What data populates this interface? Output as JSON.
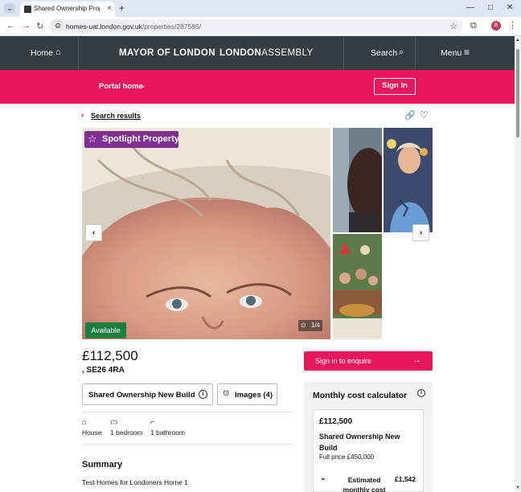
{
  "browser": {
    "tab_title": "Shared Ownership Properties | ...",
    "url_host": "homes-uat.london.gov.uk",
    "url_path": "/properties/287585/",
    "profile_initial": "B",
    "icons": [
      "back-arrow-icon",
      "forward-arrow-icon",
      "reload-icon",
      "site-info-icon",
      "star-icon",
      "extensions-icon",
      "kebab-menu-icon"
    ]
  },
  "header": {
    "home_label": "Home",
    "mayor_label": "MAYOR OF LONDON",
    "assembly_bold": "LONDON",
    "assembly_rest": "ASSEMBLY",
    "search_label": "Search",
    "menu_label": "Menu"
  },
  "subnav": {
    "portal_label": "Portal home",
    "signin_label": "Sign In"
  },
  "page": {
    "back_label": "Search results",
    "spotlight_label": "Spotlight Property",
    "status_badge": "Available",
    "image_counter": "1/4",
    "price": "£112,500",
    "postcode": ", SE26 4RA",
    "enquire_label": "Sign in to enquire",
    "type_button_label": "Shared Ownership New Build",
    "images_button_label": "Images (4)",
    "features": [
      {
        "label": "House",
        "icon": "house-icon"
      },
      {
        "label": "1 bedroom",
        "icon": "bed-icon"
      },
      {
        "label": "1 bathroom",
        "icon": "bath-icon"
      }
    ],
    "summary_heading": "Summary",
    "summary_text": "Test Homes for Londoners Home 1"
  },
  "calculator": {
    "title": "Monthly cost calculator",
    "price": "£112,500",
    "type": "Shared Ownership New Build",
    "full_price": "Full price £450,000",
    "row_label": "Estimated monthly cost",
    "row_value": "£1,542"
  },
  "colors": {
    "brand_pink": "#e8175d",
    "header_dark": "#353d42",
    "spotlight_purple": "#7e2f91",
    "available_green": "#1a7f3c"
  }
}
